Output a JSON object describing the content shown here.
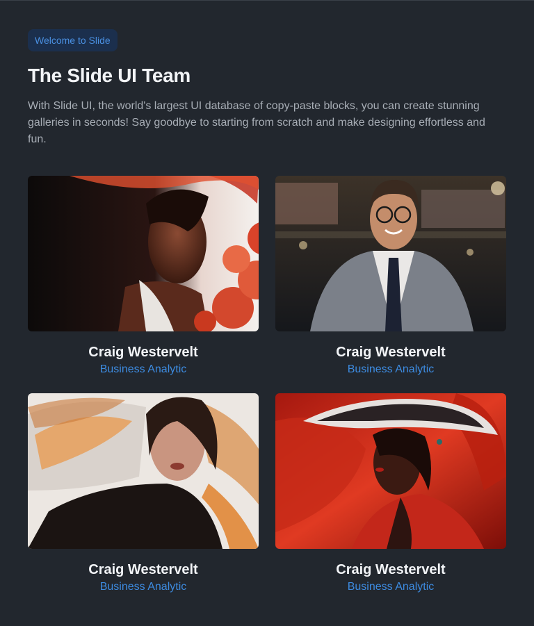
{
  "header": {
    "badge": "Welcome to Slide",
    "title": "The Slide UI Team",
    "description": "With Slide UI, the world's largest UI database of copy-paste blocks, you can create stunning galleries in seconds! Say goodbye to starting from scratch and make designing effortless and fun."
  },
  "team": [
    {
      "name": "Craig Westervelt",
      "role": "Business Analytic"
    },
    {
      "name": "Craig Westervelt",
      "role": "Business Analytic"
    },
    {
      "name": "Craig Westervelt",
      "role": "Business Analytic"
    },
    {
      "name": "Craig Westervelt",
      "role": "Business Analytic"
    }
  ],
  "colors": {
    "background": "#22272e",
    "accent": "#3d8be0",
    "badge_bg": "#1b2f4d"
  }
}
